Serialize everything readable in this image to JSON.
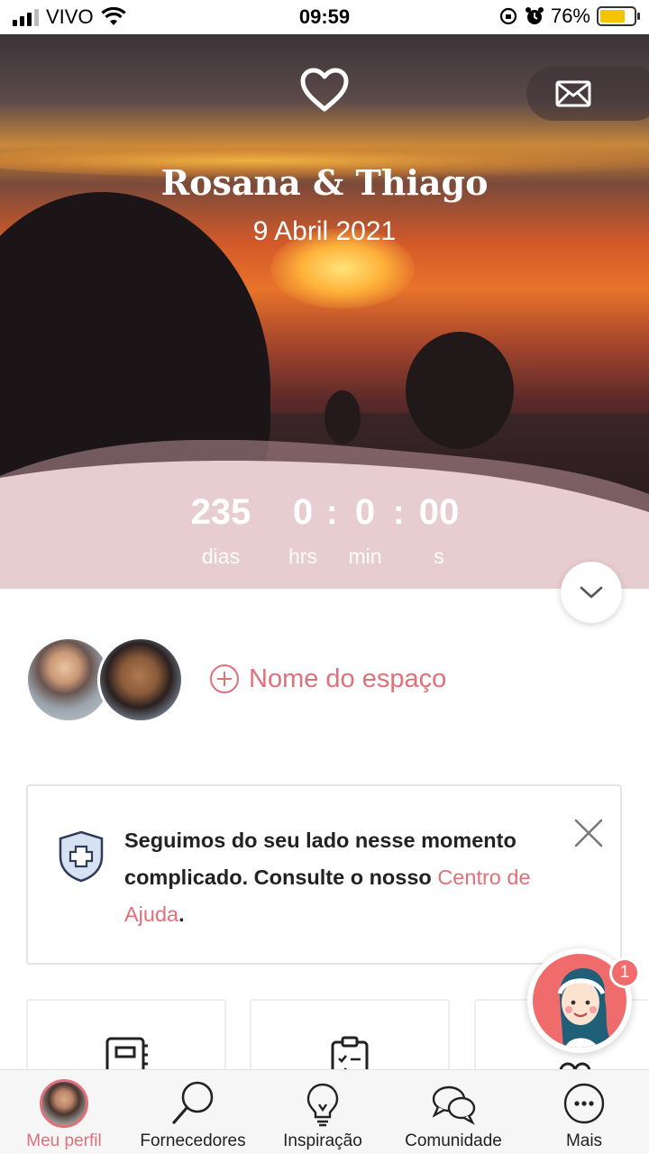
{
  "status_bar": {
    "carrier": "VIVO",
    "time": "09:59",
    "battery_percent": "76%",
    "battery_level": 0.76
  },
  "hero": {
    "couple_names": "Rosana & Thiago",
    "wedding_date": "9 Abril 2021",
    "countdown": {
      "days_value": "235",
      "days_label": "dias",
      "hours_value": "0",
      "hours_label": "hrs",
      "minutes_value": "0",
      "minutes_label": "min",
      "seconds_value": "00",
      "seconds_label": "s",
      "separator": ":"
    },
    "colors": {
      "countdown_band": "#e8cdd0",
      "accent": "#e0707a"
    }
  },
  "venue": {
    "add_label": "Nome do espaço"
  },
  "notice": {
    "text": "Seguimos do seu lado nesse momento complicado. Consulte o nosso ",
    "link_text": "Centro de Ajuda",
    "suffix": "."
  },
  "assistant": {
    "badge_count": "1"
  },
  "bottom_nav": {
    "items": [
      {
        "label": "Meu perfil",
        "icon": "profile-avatar-icon",
        "active": true
      },
      {
        "label": "Fornecedores",
        "icon": "search-icon",
        "active": false
      },
      {
        "label": "Inspiração",
        "icon": "lightbulb-icon",
        "active": false
      },
      {
        "label": "Comunidade",
        "icon": "chat-bubbles-icon",
        "active": false
      },
      {
        "label": "Mais",
        "icon": "more-dots-icon",
        "active": false
      }
    ]
  }
}
